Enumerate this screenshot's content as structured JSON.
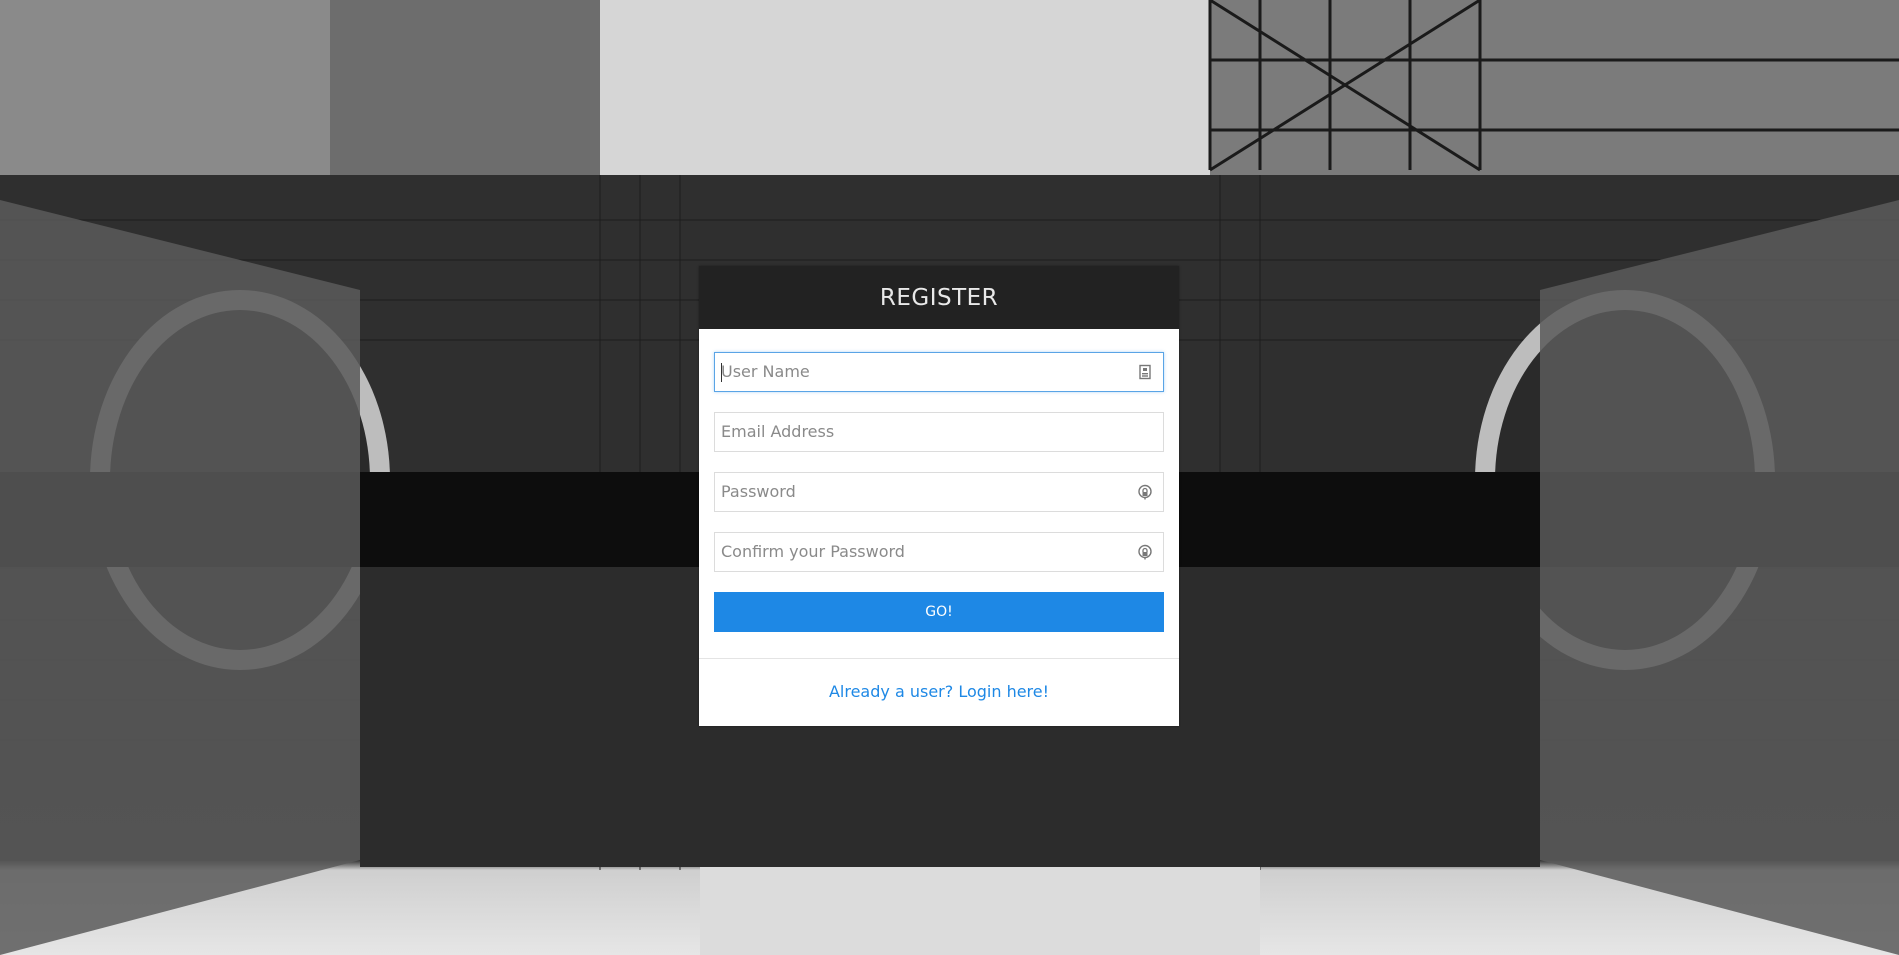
{
  "header": {
    "title": "REGISTER"
  },
  "form": {
    "username": {
      "placeholder": "User Name",
      "value": ""
    },
    "email": {
      "placeholder": "Email Address",
      "value": ""
    },
    "password": {
      "placeholder": "Password",
      "value": ""
    },
    "confirm_password": {
      "placeholder": "Confirm your Password",
      "value": ""
    },
    "submit_label": "GO!"
  },
  "footer": {
    "login_link": "Already a user? Login here!"
  },
  "colors": {
    "accent": "#1e88e5",
    "header_bg": "#222222",
    "panel_bg": "#ffffff"
  },
  "icons": {
    "username": "id-card-icon",
    "password": "lock-icon",
    "confirm_password": "lock-icon"
  }
}
